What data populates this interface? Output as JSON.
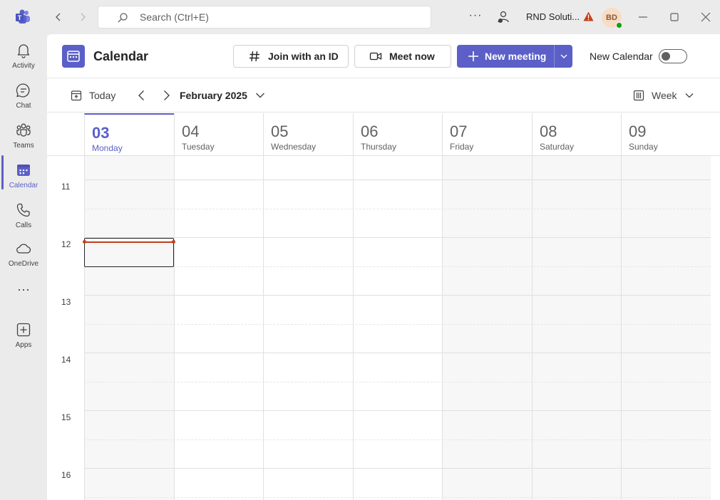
{
  "titlebar": {
    "search_placeholder": "Search (Ctrl+E)",
    "org_name": "RND Soluti...",
    "avatar_initials": "BD"
  },
  "rail": {
    "items": [
      {
        "label": "Activity",
        "icon": "bell-icon"
      },
      {
        "label": "Chat",
        "icon": "chat-icon"
      },
      {
        "label": "Teams",
        "icon": "teams-icon"
      },
      {
        "label": "Calendar",
        "icon": "calendar-icon",
        "active": true
      },
      {
        "label": "Calls",
        "icon": "phone-icon"
      },
      {
        "label": "OneDrive",
        "icon": "cloud-icon"
      },
      {
        "label": "Apps",
        "icon": "add-app-icon"
      }
    ]
  },
  "header": {
    "title": "Calendar",
    "join_label": "Join with an ID",
    "meet_label": "Meet now",
    "new_meeting_label": "New meeting",
    "new_calendar_label": "New Calendar",
    "new_calendar_enabled": false
  },
  "toolbar": {
    "today_label": "Today",
    "month_label": "February 2025",
    "view_label": "Week"
  },
  "days": [
    {
      "num": "03",
      "name": "Monday",
      "today": true
    },
    {
      "num": "04",
      "name": "Tuesday"
    },
    {
      "num": "05",
      "name": "Wednesday"
    },
    {
      "num": "06",
      "name": "Thursday"
    },
    {
      "num": "07",
      "name": "Friday"
    },
    {
      "num": "08",
      "name": "Saturday"
    },
    {
      "num": "09",
      "name": "Sunday"
    }
  ],
  "hours": [
    "11",
    "12",
    "13",
    "14",
    "15",
    "16"
  ],
  "colors": {
    "accent": "#5b5fc7",
    "now_indicator": "#c43e1c"
  }
}
